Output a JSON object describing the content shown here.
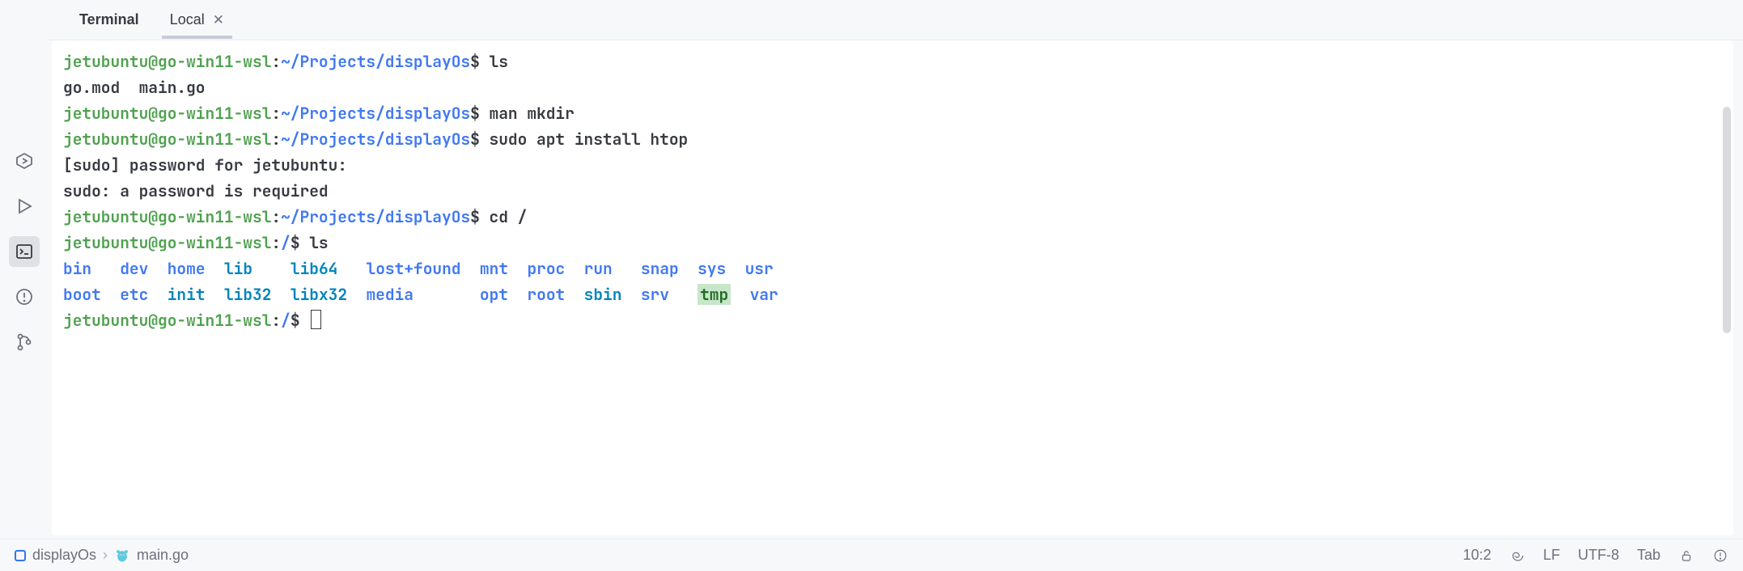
{
  "tabs": {
    "main": "Terminal",
    "secondary": "Local"
  },
  "terminal": {
    "prompt_user_host": "jetubuntu@go-win11-wsl",
    "path_home": "~/Projects/displayOs",
    "path_root": "/",
    "sep": ":",
    "dollar": "$",
    "cmds": {
      "ls": "ls",
      "man": "man mkdir",
      "sudo": "sudo apt install htop",
      "cd": "cd /",
      "ls2": "ls"
    },
    "output": {
      "ls1": "go.mod  main.go",
      "sudo1": "[sudo] password for jetubuntu:",
      "sudo2": "sudo: a password is required"
    },
    "root_listing": {
      "row1": {
        "bin": "bin",
        "dev": "dev",
        "home": "home",
        "lib": "lib",
        "lib64": "lib64",
        "lostfound": "lost+found",
        "mnt": "mnt",
        "proc": "proc",
        "run": "run",
        "snap": "snap",
        "sys": "sys",
        "usr": "usr"
      },
      "row2": {
        "boot": "boot",
        "etc": "etc",
        "init": "init",
        "lib32": "lib32",
        "libx32": "libx32",
        "media": "media",
        "opt": "opt",
        "root": "root",
        "sbin": "sbin",
        "srv": "srv",
        "tmp": "tmp",
        "var": "var"
      }
    }
  },
  "status": {
    "project": "displayOs",
    "file": "main.go",
    "pos": "10:2",
    "lf": "LF",
    "encoding": "UTF-8",
    "indent": "Tab"
  }
}
